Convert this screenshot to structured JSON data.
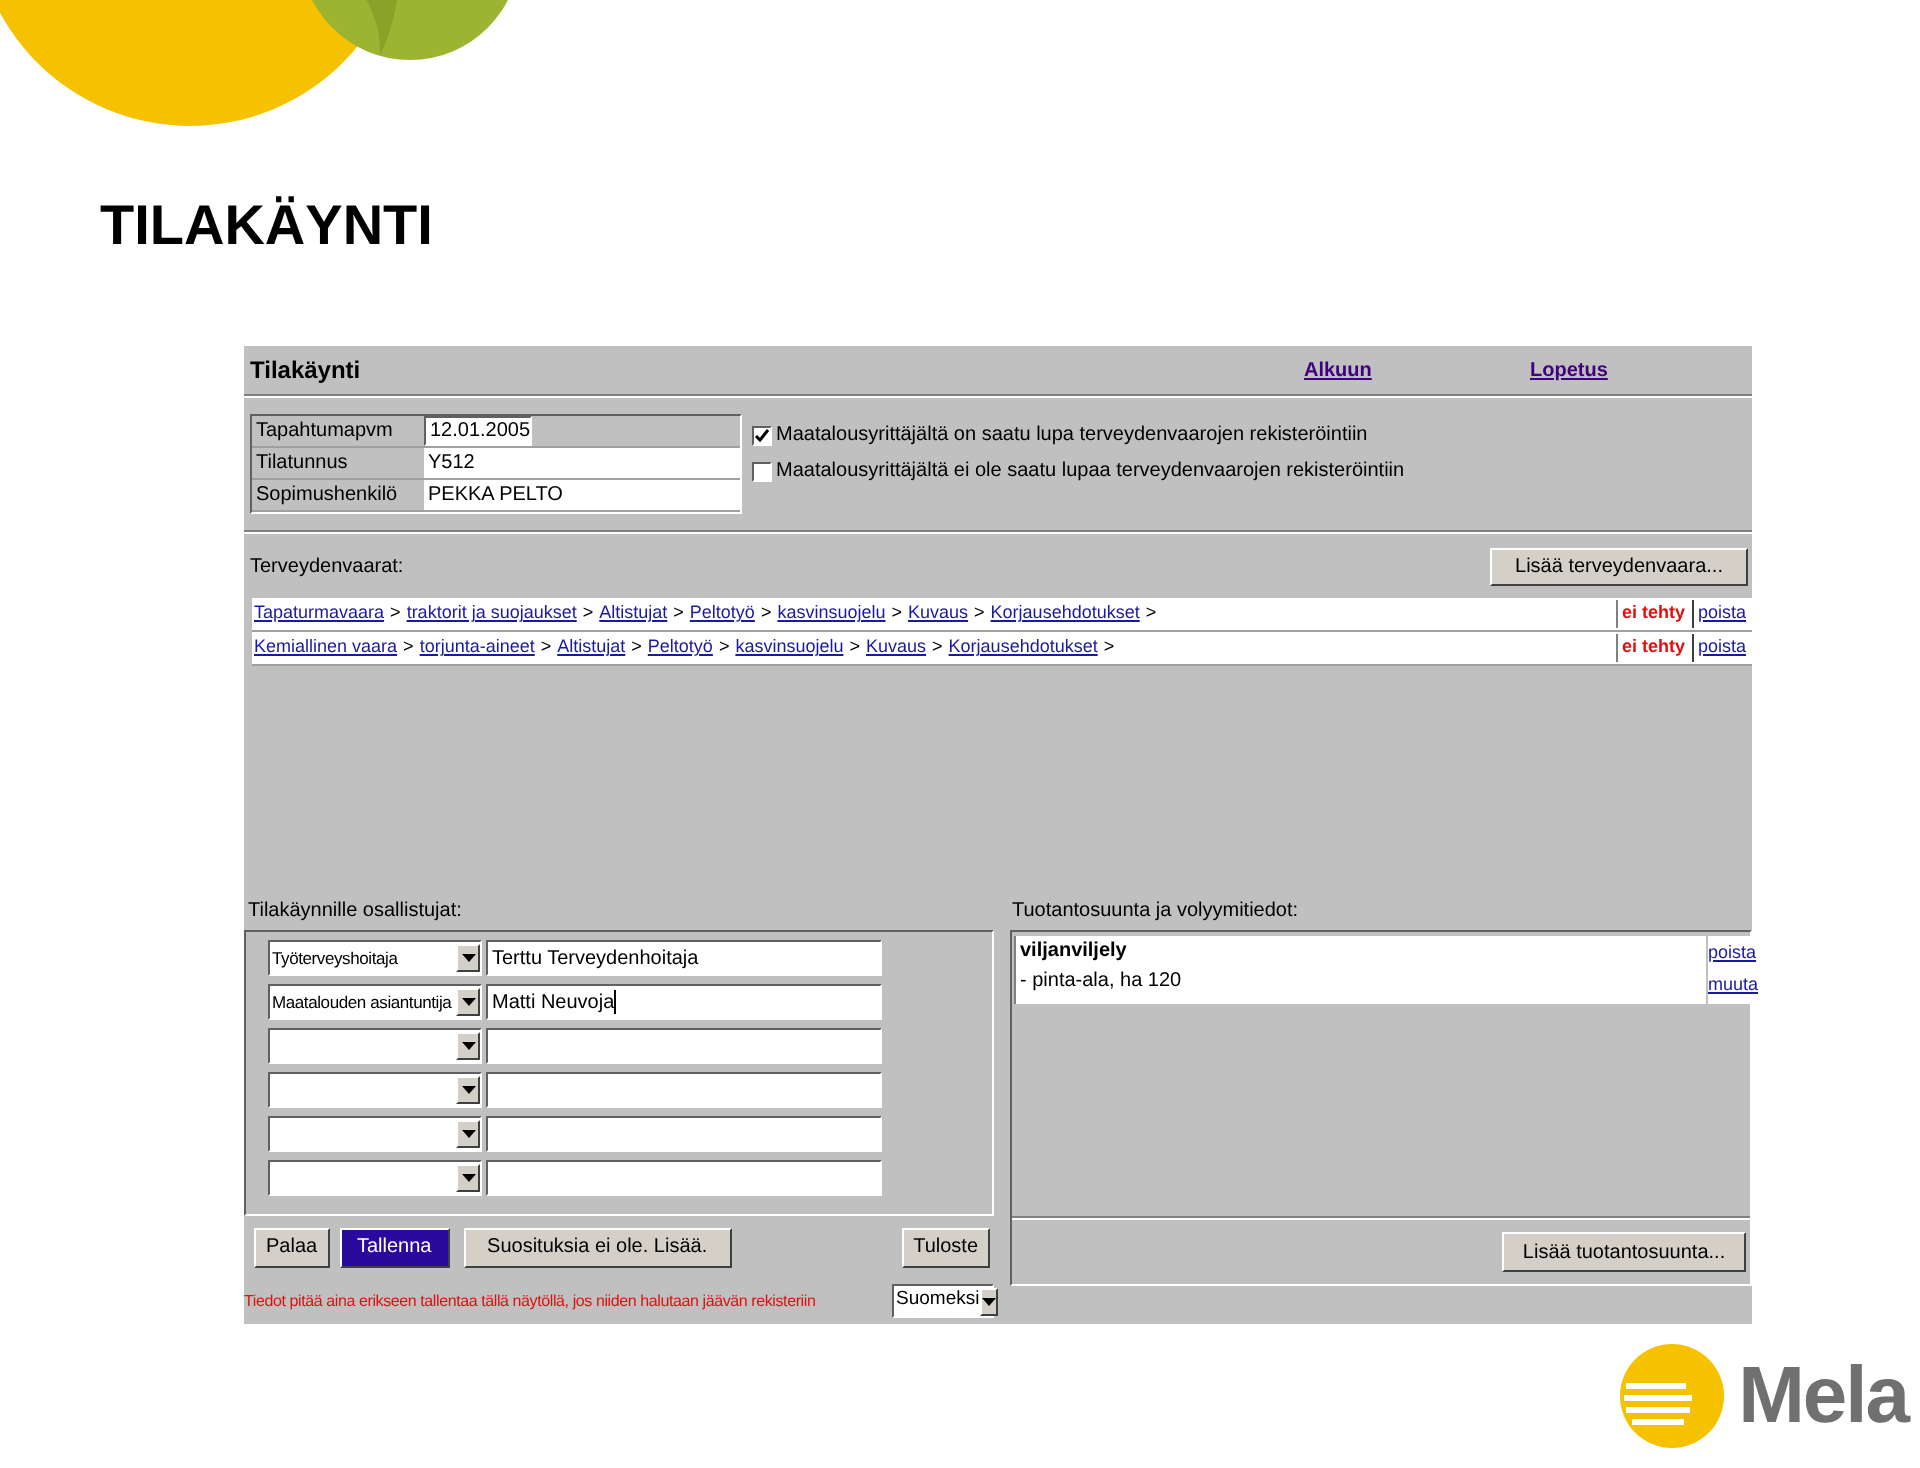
{
  "slide": {
    "title": "TILAKÄYNTI",
    "logo_text": "Mela"
  },
  "app": {
    "title": "Tilakäynti",
    "nav_links": [
      "Alkuun",
      "Lopetus"
    ],
    "info_rows": [
      {
        "label": "Tapahtumapvm",
        "value": "12.01.2005",
        "kind": "input"
      },
      {
        "label": "Tilatunnus",
        "value": "Y512",
        "kind": "text"
      },
      {
        "label": "Sopimushenkilö",
        "value": "PEKKA PELTO",
        "kind": "text"
      }
    ],
    "consent_options": [
      {
        "label": "Maatalousyrittäjältä on saatu lupa terveydenvaarojen rekisteröintiin",
        "checked": true
      },
      {
        "label": "Maatalousyrittäjältä ei ole saatu lupaa terveydenvaarojen rekisteröintiin",
        "checked": false
      }
    ],
    "hazards": {
      "heading": "Terveydenvaarat:",
      "add_button": "Lisää terveydenvaara...",
      "rows": [
        {
          "crumbs": [
            "Tapaturmavaara",
            "traktorit ja suojaukset",
            "Altistujat",
            "Peltotyö",
            "kasvinsuojelu",
            "Kuvaus",
            "Korjausehdotukset"
          ],
          "separator": ">",
          "status": "ei tehty",
          "action": "poista"
        },
        {
          "crumbs": [
            "Kemiallinen vaara",
            "torjunta-aineet",
            "Altistujat",
            "Peltotyö",
            "kasvinsuojelu",
            "Kuvaus",
            "Korjausehdotukset"
          ],
          "separator": ">",
          "status": "ei tehty",
          "action": "poista"
        }
      ]
    },
    "participants": {
      "heading": "Tilakäynnille osallistujat:",
      "rows": [
        {
          "role": "Työterveyshoitaja",
          "name": "Terttu Terveydenhoitaja",
          "focused": false
        },
        {
          "role": "Maatalouden asiantuntija",
          "name": "Matti Neuvoja",
          "focused": true
        },
        {
          "focused": false
        },
        {
          "focused": false
        },
        {
          "focused": false
        },
        {
          "focused": false
        }
      ]
    },
    "buttons": [
      {
        "label": "Palaa",
        "kind": "normal"
      },
      {
        "label": "Tallenna",
        "kind": "primary"
      },
      {
        "label": "Suosituksia ei ole. Lisää.",
        "kind": "normal"
      }
    ],
    "print_button": "Tuloste",
    "language_select": "Suomeksi",
    "notice": "Tiedot pitää aina erikseen tallentaa tällä näytöllä, jos niiden halutaan jäävän rekisteriin",
    "production": {
      "heading": "Tuotantosuunta ja volyymitiedot:",
      "entries": [
        {
          "title": "viljanviljely",
          "detail": "- pinta-ala, ha 120",
          "actions": [
            "poista",
            "muuta"
          ]
        }
      ],
      "add_button": "Lisää tuotantosuunta..."
    }
  }
}
